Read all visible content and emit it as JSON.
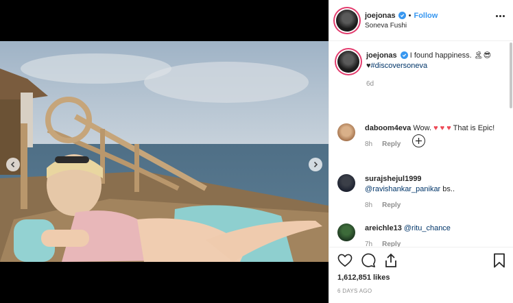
{
  "post": {
    "author": "joejonas",
    "follow_label": "Follow",
    "location": "Soneva Fushi",
    "caption_text": "I found happiness. 🏝😎",
    "caption_tag_prefix": "♥",
    "caption_hashtag": "#discoversoneva",
    "caption_age": "6d"
  },
  "comments": [
    {
      "user": "daboom4eva",
      "text_before": "Wow.",
      "hearts": "♥ ♥ ♥",
      "text_after": "That is Epic!",
      "age": "8h",
      "reply_label": "Reply"
    },
    {
      "user": "surajshejul1999",
      "mention": "@ravishankar_panikar",
      "text_after": "bs..",
      "age": "8h",
      "reply_label": "Reply"
    },
    {
      "user": "areichle13",
      "mention": "@ritu_chance",
      "age": "7h",
      "reply_label": "Reply"
    }
  ],
  "actions": {
    "likes": "1,612,851 likes",
    "time_ago": "6 DAYS AGO"
  },
  "colors": {
    "accent": "#3897f0",
    "link": "#003569",
    "muted": "#8e8e8e",
    "story_ring": "#e23b6d"
  }
}
